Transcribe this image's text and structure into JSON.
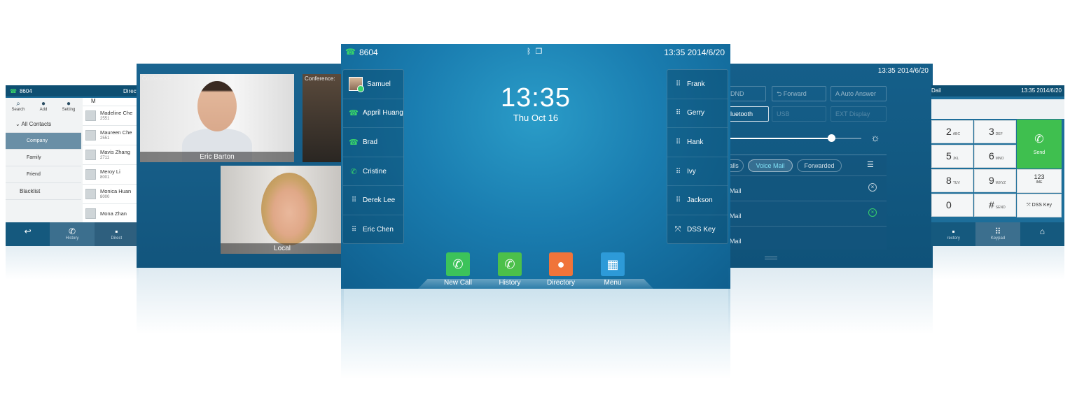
{
  "directory_screen": {
    "extension": "8604",
    "title_partial": "Direct",
    "toolbar": [
      {
        "label": "Search",
        "icon": "search-icon"
      },
      {
        "label": "Add",
        "icon": "add-contact-icon"
      },
      {
        "label": "Setting",
        "icon": "settings-icon"
      }
    ],
    "groups": [
      {
        "label": "All Contacts",
        "selected": false
      },
      {
        "label": "Company",
        "selected": true
      },
      {
        "label": "Family",
        "selected": false
      },
      {
        "label": "Friend",
        "selected": false
      },
      {
        "label": "Blacklist",
        "selected": false
      }
    ],
    "index_letter": "M",
    "contacts": [
      {
        "name": "Madeline Che",
        "number": "2551"
      },
      {
        "name": "Maureen Che",
        "number": "2551"
      },
      {
        "name": "Mavis Zhang",
        "number": "2711"
      },
      {
        "name": "Meroy Li",
        "number": "8001"
      },
      {
        "name": "Monica Huan",
        "number": "8000"
      },
      {
        "name": "Mona Zhan",
        "number": ""
      }
    ],
    "bottom_tabs": [
      "",
      "History",
      "Direct"
    ]
  },
  "video_screen": {
    "tiles": [
      {
        "tag": "Conference:",
        "label": "Eric Barton"
      },
      {
        "tag": "Conference:",
        "label": ""
      },
      {
        "tag": "",
        "label": "Local"
      }
    ]
  },
  "main_screen": {
    "extension": "8604",
    "datetime": "13:35  2014/6/20",
    "clock": "13:35",
    "date": "Thu Oct 16",
    "left_keys": [
      {
        "label": "Samuel",
        "icon": "contact-photo"
      },
      {
        "label": "Appril Huang",
        "icon": "phone-handset-icon"
      },
      {
        "label": "Brad",
        "icon": "phone-handset-icon"
      },
      {
        "label": "Cristine",
        "icon": "phone-icon"
      },
      {
        "label": "Derek Lee",
        "icon": "keypad-icon"
      },
      {
        "label": "Eric Chen",
        "icon": "keypad-icon"
      }
    ],
    "right_keys": [
      {
        "label": "Frank",
        "icon": "keypad-icon"
      },
      {
        "label": "Gerry",
        "icon": "keypad-icon"
      },
      {
        "label": "Hank",
        "icon": "keypad-icon"
      },
      {
        "label": "Ivy",
        "icon": "keypad-icon"
      },
      {
        "label": "Jackson",
        "icon": "keypad-icon"
      },
      {
        "label": "DSS Key",
        "icon": "expand-icon"
      }
    ],
    "apps": [
      {
        "label": "New Call",
        "color": "#3cc35a"
      },
      {
        "label": "History",
        "color": "#4cc04a"
      },
      {
        "label": "Directory",
        "color": "#f0743a"
      },
      {
        "label": "Menu",
        "color": "#2d9ad8"
      }
    ]
  },
  "settings_screen": {
    "datetime": "13:35  2014/6/20",
    "buttons": [
      {
        "label": "DND",
        "on": false
      },
      {
        "label": "Forward",
        "on": false
      },
      {
        "label": "Auto Answer",
        "on": false
      },
      {
        "label": "luetooth",
        "on": true
      },
      {
        "label": "USB",
        "on": false
      },
      {
        "label": "EXT Display",
        "on": false
      }
    ],
    "brightness_level": 0.78,
    "filters": [
      {
        "label": "alls",
        "on": false
      },
      {
        "label": "Voice Mail",
        "on": true
      },
      {
        "label": "Forwarded",
        "on": false
      }
    ],
    "rows": [
      "Mail",
      "Mail",
      "Mail"
    ]
  },
  "keypad_screen": {
    "title_partial": "Dail",
    "datetime": "13:35  2014/6/20",
    "keys": [
      {
        "digit": "2",
        "sub": "ABC"
      },
      {
        "digit": "3",
        "sub": "DEF"
      },
      {
        "digit": "5",
        "sub": "JKL"
      },
      {
        "digit": "6",
        "sub": "MNO"
      },
      {
        "digit": "8",
        "sub": "TUV"
      },
      {
        "digit": "9",
        "sub": "WXYZ"
      },
      {
        "digit": "0",
        "sub": ""
      },
      {
        "digit": "#",
        "sub": "SEND"
      }
    ],
    "send_label": "Send",
    "ime_label": "123",
    "ime_sub": "IME",
    "dss_label": "DSS Key",
    "bottom_tabs": [
      "rectory",
      "Keypad",
      ""
    ]
  },
  "colors": {
    "screen_blue": "#1a7db0",
    "green_call": "#38d46a",
    "send_green": "#3fbf4f"
  }
}
